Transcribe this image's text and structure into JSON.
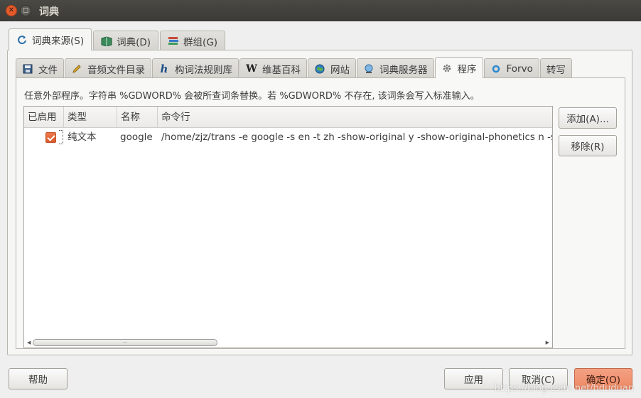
{
  "window": {
    "title": "词典"
  },
  "main_tabs": [
    {
      "label": "词典来源(S)",
      "icon": "refresh-icon"
    },
    {
      "label": "词典(D)",
      "icon": "book-icon"
    },
    {
      "label": "群组(G)",
      "icon": "books-stack-icon"
    }
  ],
  "source_tabs": [
    {
      "label": "文件",
      "icon": "floppy-icon"
    },
    {
      "label": "音频文件目录",
      "icon": "pencil-icon"
    },
    {
      "label": "构词法规则库",
      "icon": "hunspell-h-icon"
    },
    {
      "label": "维基百科",
      "icon": "wikipedia-w-icon"
    },
    {
      "label": "网站",
      "icon": "globe-icon"
    },
    {
      "label": "词典服务器",
      "icon": "server-globe-icon"
    },
    {
      "label": "程序",
      "icon": "gear-icon"
    },
    {
      "label": "Forvo",
      "icon": "forvo-icon"
    },
    {
      "label": "转写",
      "icon": ""
    }
  ],
  "programs": {
    "description": "任意外部程序。字符串 %GDWORD% 会被所查词条替换。若 %GDWORD% 不存在, 该词条会写入标准输入。",
    "columns": [
      "已启用",
      "类型",
      "名称",
      "命令行"
    ],
    "rows": [
      {
        "enabled": true,
        "type": "纯文本",
        "name": "google",
        "command": "/home/zjz/trans -e google -s en -t zh -show-original y -show-original-phonetics n -s"
      }
    ],
    "scroll_dots": "···"
  },
  "buttons": {
    "add": "添加(A)...",
    "remove": "移除(R)",
    "help": "帮助",
    "apply": "应用",
    "cancel": "取消(C)",
    "ok": "确定(O)"
  },
  "watermark": "https://blog.csdn.net/hduduan"
}
